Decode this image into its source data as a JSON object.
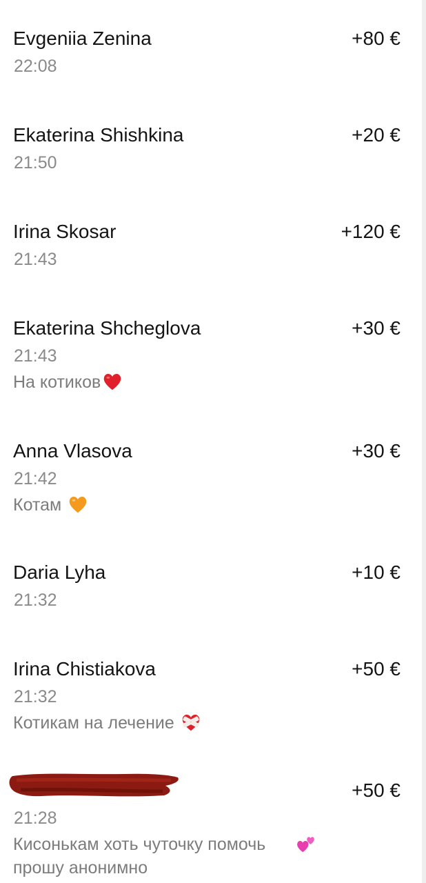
{
  "transactions": [
    {
      "name": "Evgeniia Zenina",
      "amount": "+80 €",
      "time": "22:08",
      "comment": ""
    },
    {
      "name": "Ekaterina Shishkina",
      "amount": "+20 €",
      "time": "21:50",
      "comment": ""
    },
    {
      "name": "Irina Skosar",
      "amount": "+120 €",
      "time": "21:43",
      "comment": ""
    },
    {
      "name": "Ekaterina Shcheglova",
      "amount": "+30 €",
      "time": "21:43",
      "comment": "На котиков",
      "emoji": "red-heart-icon",
      "emoji_color": "#e0202a"
    },
    {
      "name": "Anna Vlasova",
      "amount": "+30 €",
      "time": "21:42",
      "comment": "Котам ",
      "emoji": "orange-heart-icon",
      "emoji_color": "#f39a1f"
    },
    {
      "name": "Daria Lyha",
      "amount": "+10 €",
      "time": "21:32",
      "comment": ""
    },
    {
      "name": "Irina Chistiakova",
      "amount": "+50 €",
      "time": "21:32",
      "comment": "Котикам на лечение ",
      "emoji": "mending-heart-icon",
      "emoji_color": "#e0202a"
    },
    {
      "name": "",
      "amount": "+50 €",
      "time": "21:28",
      "comment": "Кисонькам хоть чуточку помочь \nпрошу анонимно",
      "emoji": "two-hearts-icon",
      "emoji_color": "#e83fb0",
      "redacted": true,
      "redaction_color": "#8b1a12"
    }
  ]
}
